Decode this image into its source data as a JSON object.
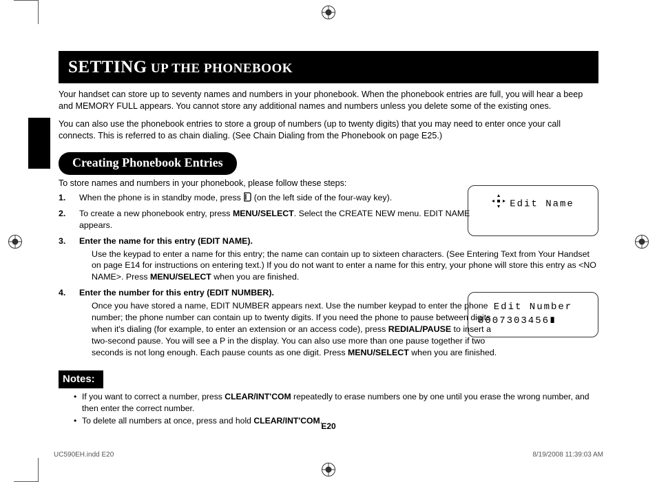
{
  "title": {
    "big": "SETTING",
    "small": " UP THE PHONEBOOK"
  },
  "intro": [
    "Your handset can store up to seventy names and numbers in your phonebook. When the phonebook entries are full, you will hear a beep and MEMORY FULL appears. You cannot store any additional names and numbers unless you delete some of the existing ones.",
    "You can also use the phonebook entries to store a group of numbers (up to twenty digits) that you may need to enter once your call connects. This is referred to as chain dialing. (See Chain Dialing from the Phonebook on page E25.)"
  ],
  "subheader": "Creating Phonebook Entries",
  "follow": "To store names and numbers in your phonebook, please follow these steps:",
  "steps": {
    "s1_a": "When the phone is in standby mode, press ",
    "s1_b": " (on the left side of the four-way key).",
    "s2_a": "To create a new phonebook entry, press ",
    "s2_key": "MENU/SELECT",
    "s2_b": ". Select the CREATE NEW menu. EDIT NAME appears.",
    "s3_title": "Enter the name for this entry (EDIT NAME).",
    "s3_body_a": "Use the keypad to enter a name for this entry; the name can contain up to sixteen characters. (See Entering Text from Your Handset on page E14 for instructions on entering text.) If you do not want to enter a name for this entry, your phone will store this entry as <NO NAME>. Press ",
    "s3_key": "MENU/SELECT",
    "s3_body_b": " when you are finished.",
    "s4_title": "Enter the number for this entry (EDIT NUMBER).",
    "s4_body_a": "Once you have stored a name, EDIT NUMBER appears next. Use the number keypad to enter the phone number; the phone number can contain up to twenty digits. If you need the phone to pause between digits when it's dialing (for example, to enter an extension or an access code), press ",
    "s4_key1": "REDIAL/PAUSE",
    "s4_body_b": " to insert a two-second pause. You will see a P in the display. You can also use more than one pause together if two seconds is not long enough. Each pause counts as one digit. Press ",
    "s4_key2": "MENU/SELECT",
    "s4_body_c": " when you are finished."
  },
  "lcd1": "Edit Name",
  "lcd2_line1": "Edit Number",
  "lcd2_line2": "8007303456∎",
  "notes_label": "Notes:",
  "notes": {
    "n1_a": "If you want to correct a number, press ",
    "n1_key": "CLEAR/INT'COM",
    "n1_b": " repeatedly to erase numbers one by one until you erase the wrong number, and then enter the correct number.",
    "n2_a": "To delete all numbers at once, press and hold ",
    "n2_key": "CLEAR/INT'COM",
    "n2_b": "."
  },
  "page_number": "E20",
  "footer_left": "UC590EH.indd   E20",
  "footer_right": "8/19/2008   11:39:03 AM"
}
